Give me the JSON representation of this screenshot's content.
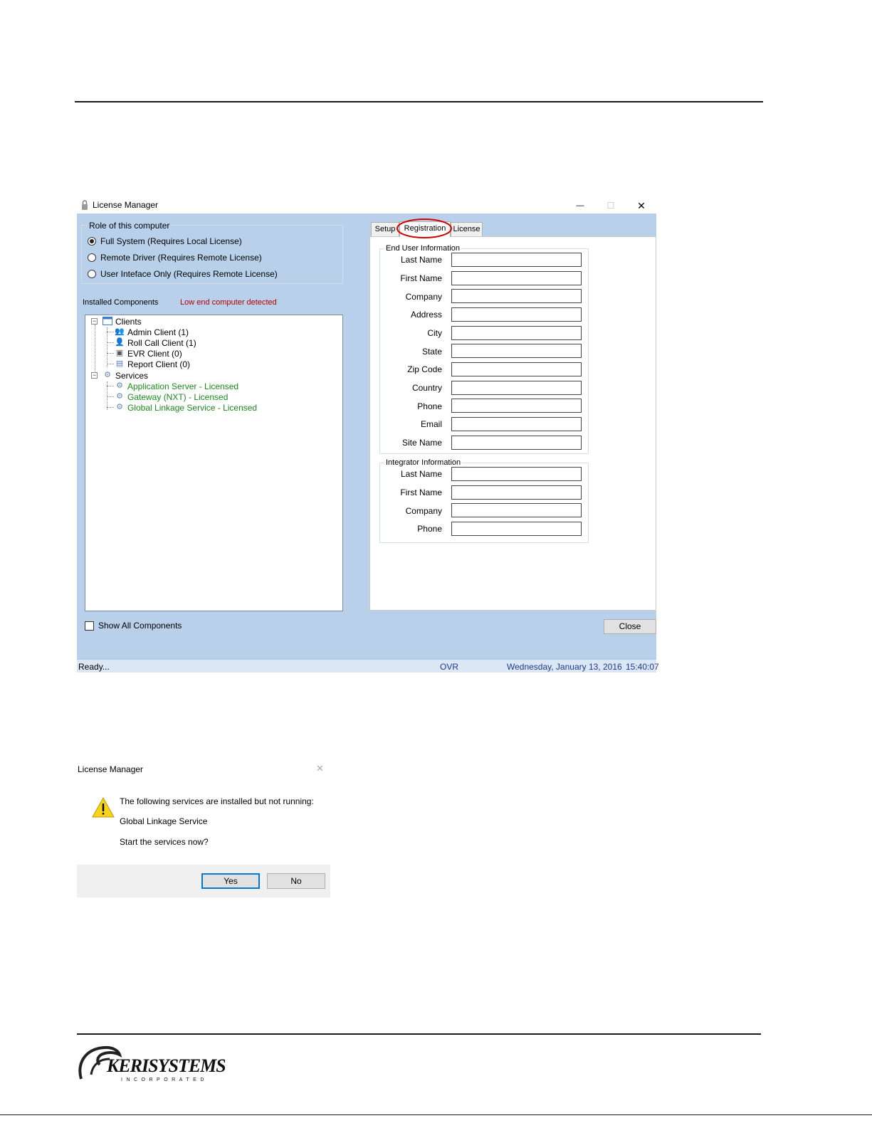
{
  "window": {
    "title": "License Manager",
    "minimize_glyph": "—",
    "maximize_glyph": "☐",
    "close_glyph": "✕"
  },
  "role": {
    "group_label": "Role of this computer",
    "options": [
      {
        "label": "Full System (Requires Local License)",
        "selected": true
      },
      {
        "label": "Remote Driver (Requires Remote License)",
        "selected": false
      },
      {
        "label": "User Inteface Only (Requires Remote License)",
        "selected": false
      }
    ]
  },
  "components": {
    "label": "Installed Components",
    "warning": "Low end computer detected",
    "warning_color": "#b00000",
    "clients_label": "Clients",
    "clients": [
      "Admin Client (1)",
      "Roll Call Client (1)",
      "EVR Client (0)",
      "Report Client (0)"
    ],
    "services_label": "Services",
    "services": [
      "Application Server - Licensed",
      "Gateway (NXT) - Licensed",
      "Global Linkage Service - Licensed"
    ],
    "licensed_color": "#1a8a1a",
    "show_all_label": "Show All Components"
  },
  "tabs": {
    "setup": "Setup",
    "registration": "Registration",
    "license": "License",
    "active": "Registration",
    "highlight_color": "#d00000"
  },
  "end_user": {
    "group_label": "End User Information",
    "fields": [
      {
        "label": "Last Name",
        "value": ""
      },
      {
        "label": "First Name",
        "value": ""
      },
      {
        "label": "Company",
        "value": ""
      },
      {
        "label": "Address",
        "value": ""
      },
      {
        "label": "City",
        "value": ""
      },
      {
        "label": "State",
        "value": ""
      },
      {
        "label": "Zip Code",
        "value": ""
      },
      {
        "label": "Country",
        "value": ""
      },
      {
        "label": "Phone",
        "value": ""
      },
      {
        "label": "Email",
        "value": ""
      },
      {
        "label": "Site Name",
        "value": ""
      }
    ]
  },
  "integrator": {
    "group_label": "Integrator Information",
    "fields": [
      {
        "label": "Last Name",
        "value": ""
      },
      {
        "label": "First Name",
        "value": ""
      },
      {
        "label": "Company",
        "value": ""
      },
      {
        "label": "Phone",
        "value": ""
      }
    ]
  },
  "close_label": "Close",
  "status": {
    "ready": "Ready...",
    "mode": "OVR",
    "date": "Wednesday, January 13, 2016",
    "time": "15:40:07"
  },
  "dialog": {
    "title": "License Manager",
    "close_glyph": "✕",
    "line1": "The following services are installed but not running:",
    "line2": "Global Linkage Service",
    "line3": "Start the services now?",
    "yes_label": "Yes",
    "no_label": "No"
  },
  "logo": {
    "brand": "KERISYSTEMS",
    "tagline": "INCORPORATED"
  }
}
